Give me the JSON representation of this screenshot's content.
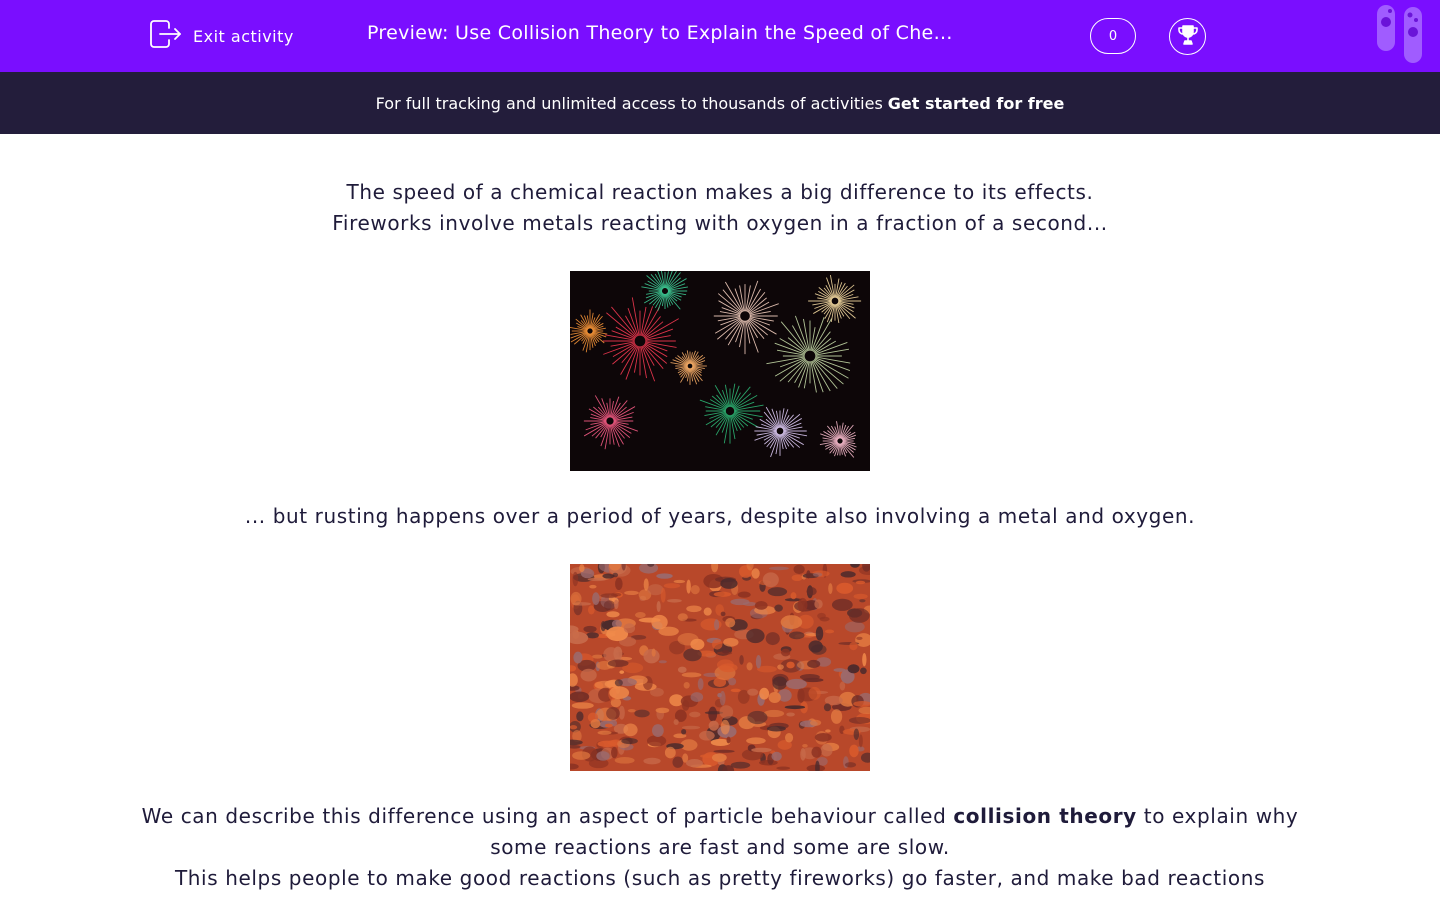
{
  "header": {
    "exit_label": "Exit activity",
    "title": "Preview: Use Collision Theory to Explain the Speed of Che…",
    "score": "0",
    "colors": {
      "bar": "#7a0eff",
      "promo": "#231d3b"
    }
  },
  "promo": {
    "text": "For full tracking and unlimited access to thousands of activities",
    "cta": "Get started for free"
  },
  "content": {
    "para1_line1": "The speed of a chemical reaction makes a big difference to its effects.",
    "para1_line2": "Fireworks involve metals reacting with oxygen in a fraction of a second...",
    "para2": "... but rusting happens over a period of years, despite also involving a metal and oxygen.",
    "para3_before": "We can describe this difference using an aspect of particle behaviour called ",
    "para3_bold": "collision theory",
    "para3_after": " to explain why some reactions are fast and some are slow.",
    "para4": "This helps people to make good reactions (such as pretty fireworks) go faster, and make bad reactions"
  },
  "icons": {
    "exit": "exit-icon",
    "trophy": "trophy-icon",
    "tubes": "test-tubes-icon"
  }
}
